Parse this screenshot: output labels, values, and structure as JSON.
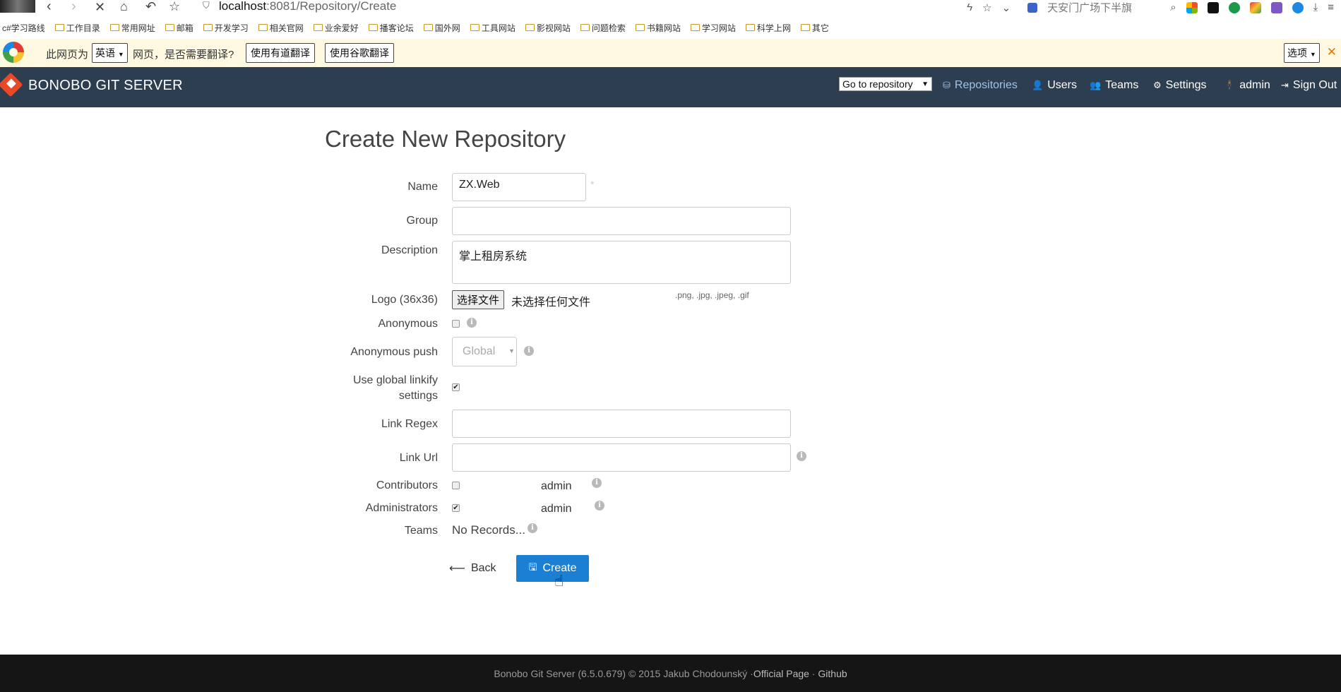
{
  "browser": {
    "url_host": "localhost",
    "url_path": ":8081/Repository/Create",
    "news_text": "天安门广场下半旗",
    "nav_icons": [
      "back-icon",
      "forward-icon",
      "stop-icon",
      "home-icon",
      "undo-icon",
      "star-icon"
    ],
    "bookmarks": [
      "c#学习路线",
      "工作目录",
      "常用网址",
      "邮箱",
      "开发学习",
      "相关官网",
      "业余爱好",
      "播客论坛",
      "国外网",
      "工具网站",
      "影视网站",
      "问题检索",
      "书籍网站",
      "学习网站",
      "科学上网",
      "其它"
    ]
  },
  "translate_bar": {
    "prefix": "此网页为",
    "language": "英语",
    "question": "网页，是否需要翻译?",
    "youdao_button": "使用有道翻译",
    "google_button": "使用谷歌翻译",
    "options": "选项"
  },
  "navbar": {
    "brand": "BONOBO GIT SERVER",
    "goto_repository": "Go to repository",
    "links": {
      "repositories": "Repositories",
      "users": "Users",
      "teams": "Teams",
      "settings": "Settings",
      "admin": "admin",
      "sign_out": "Sign Out"
    },
    "accent_color": "#9fc4e8",
    "background": "#2c3e50"
  },
  "form": {
    "title": "Create New Repository",
    "name_label": "Name",
    "name_value": "ZX.Web",
    "required_mark": "*",
    "group_label": "Group",
    "group_value": "",
    "description_label": "Description",
    "description_value": "掌上租房系统",
    "logo_label": "Logo (36x36)",
    "file_button": "选择文件",
    "file_status": "未选择任何文件",
    "file_types": ".png, .jpg, .jpeg, .gif",
    "anonymous_label": "Anonymous",
    "anonymous_checked": false,
    "anonymous_push_label": "Anonymous push",
    "anonymous_push_value": "Global",
    "linkify_label_line1": "Use global linkify",
    "linkify_label_line2": "settings",
    "linkify_checked": true,
    "link_regex_label": "Link Regex",
    "link_regex_value": "",
    "link_url_label": "Link Url",
    "link_url_value": "",
    "contributors_label": "Contributors",
    "contributors_user": "admin",
    "contributors_checked": false,
    "administrators_label": "Administrators",
    "administrators_user": "admin",
    "administrators_checked": true,
    "teams_label": "Teams",
    "teams_value": "No Records...",
    "back_button": "Back",
    "create_button": "Create",
    "primary_color": "#1b7fd4"
  },
  "footer": {
    "text": "Bonobo Git Server (6.5.0.679) © 2015 Jakub Chodounský · ",
    "official_page": "Official Page",
    "separator": " · ",
    "github": "Github"
  }
}
